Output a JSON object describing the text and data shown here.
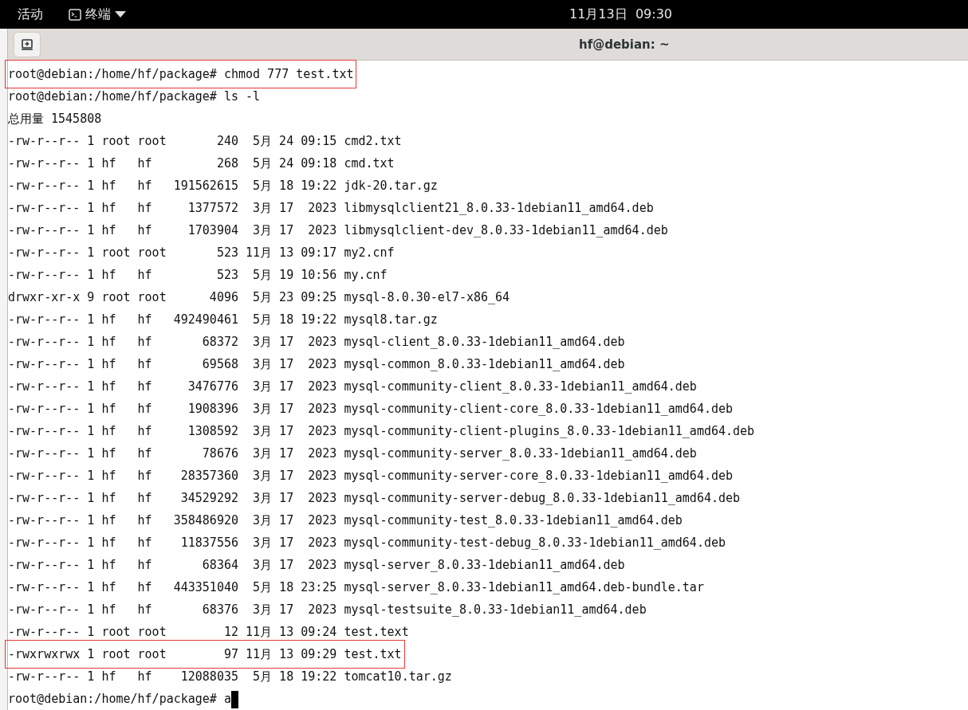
{
  "top_bar": {
    "activities": "活动",
    "app_menu": "终端",
    "clock": "11月13日  09:30"
  },
  "window": {
    "title": "hf@debian: ~"
  },
  "terminal": {
    "lines": [
      {
        "text": "root@debian:/home/hf/package# chmod 777 test.txt",
        "highlighted": true
      },
      {
        "text": "root@debian:/home/hf/package# ls -l",
        "highlighted": false
      },
      {
        "text": "总用量 1545808",
        "highlighted": false
      },
      {
        "text": "-rw-r--r-- 1 root root       240  5月 24 09:15 cmd2.txt",
        "highlighted": false
      },
      {
        "text": "-rw-r--r-- 1 hf   hf         268  5月 24 09:18 cmd.txt",
        "highlighted": false
      },
      {
        "text": "-rw-r--r-- 1 hf   hf   191562615  5月 18 19:22 jdk-20.tar.gz",
        "highlighted": false
      },
      {
        "text": "-rw-r--r-- 1 hf   hf     1377572  3月 17  2023 libmysqlclient21_8.0.33-1debian11_amd64.deb",
        "highlighted": false
      },
      {
        "text": "-rw-r--r-- 1 hf   hf     1703904  3月 17  2023 libmysqlclient-dev_8.0.33-1debian11_amd64.deb",
        "highlighted": false
      },
      {
        "text": "-rw-r--r-- 1 root root       523 11月 13 09:17 my2.cnf",
        "highlighted": false
      },
      {
        "text": "-rw-r--r-- 1 hf   hf         523  5月 19 10:56 my.cnf",
        "highlighted": false
      },
      {
        "text": "drwxr-xr-x 9 root root      4096  5月 23 09:25 mysql-8.0.30-el7-x86_64",
        "highlighted": false
      },
      {
        "text": "-rw-r--r-- 1 hf   hf   492490461  5月 18 19:22 mysql8.tar.gz",
        "highlighted": false
      },
      {
        "text": "-rw-r--r-- 1 hf   hf       68372  3月 17  2023 mysql-client_8.0.33-1debian11_amd64.deb",
        "highlighted": false
      },
      {
        "text": "-rw-r--r-- 1 hf   hf       69568  3月 17  2023 mysql-common_8.0.33-1debian11_amd64.deb",
        "highlighted": false
      },
      {
        "text": "-rw-r--r-- 1 hf   hf     3476776  3月 17  2023 mysql-community-client_8.0.33-1debian11_amd64.deb",
        "highlighted": false
      },
      {
        "text": "-rw-r--r-- 1 hf   hf     1908396  3月 17  2023 mysql-community-client-core_8.0.33-1debian11_amd64.deb",
        "highlighted": false
      },
      {
        "text": "-rw-r--r-- 1 hf   hf     1308592  3月 17  2023 mysql-community-client-plugins_8.0.33-1debian11_amd64.deb",
        "highlighted": false
      },
      {
        "text": "-rw-r--r-- 1 hf   hf       78676  3月 17  2023 mysql-community-server_8.0.33-1debian11_amd64.deb",
        "highlighted": false
      },
      {
        "text": "-rw-r--r-- 1 hf   hf    28357360  3月 17  2023 mysql-community-server-core_8.0.33-1debian11_amd64.deb",
        "highlighted": false
      },
      {
        "text": "-rw-r--r-- 1 hf   hf    34529292  3月 17  2023 mysql-community-server-debug_8.0.33-1debian11_amd64.deb",
        "highlighted": false
      },
      {
        "text": "-rw-r--r-- 1 hf   hf   358486920  3月 17  2023 mysql-community-test_8.0.33-1debian11_amd64.deb",
        "highlighted": false
      },
      {
        "text": "-rw-r--r-- 1 hf   hf    11837556  3月 17  2023 mysql-community-test-debug_8.0.33-1debian11_amd64.deb",
        "highlighted": false
      },
      {
        "text": "-rw-r--r-- 1 hf   hf       68364  3月 17  2023 mysql-server_8.0.33-1debian11_amd64.deb",
        "highlighted": false
      },
      {
        "text": "-rw-r--r-- 1 hf   hf   443351040  5月 18 23:25 mysql-server_8.0.33-1debian11_amd64.deb-bundle.tar",
        "highlighted": false
      },
      {
        "text": "-rw-r--r-- 1 hf   hf       68376  3月 17  2023 mysql-testsuite_8.0.33-1debian11_amd64.deb",
        "highlighted": false
      },
      {
        "text": "-rw-r--r-- 1 root root        12 11月 13 09:24 test.text",
        "highlighted": false
      },
      {
        "text": "-rwxrwxrwx 1 root root        97 11月 13 09:29 test.txt",
        "highlighted": true
      },
      {
        "text": "-rw-r--r-- 1 hf   hf    12088035  5月 18 19:22 tomcat10.tar.gz",
        "highlighted": false
      }
    ],
    "prompt": "root@debian:/home/hf/package# a"
  }
}
